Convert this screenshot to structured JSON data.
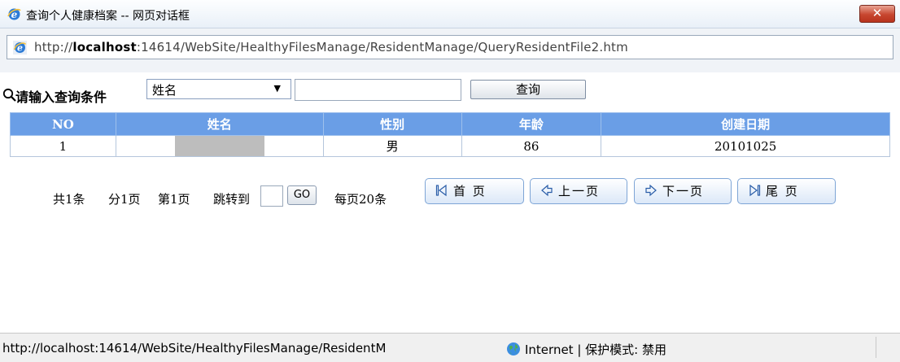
{
  "window": {
    "title": "查询个人健康档案 -- 网页对话框",
    "close_label": "✕"
  },
  "address": {
    "url_prefix": "http://",
    "url_host": "localhost",
    "url_rest": ":14614/WebSite/HealthyFilesManage/ResidentManage/QueryResidentFile2.htm"
  },
  "query": {
    "label": "请输入查询条件",
    "select_value": "姓名",
    "input_value": "",
    "button_label": "查询"
  },
  "table": {
    "headers": [
      "NO",
      "姓名",
      "性别",
      "年龄",
      "创建日期"
    ],
    "rows": [
      {
        "no": "1",
        "name": "",
        "gender": "男",
        "age": "86",
        "date": "20101025"
      }
    ]
  },
  "pager": {
    "total": "共1条",
    "pages": "分1页",
    "current": "第1页",
    "jump_label": "跳转到",
    "jump_value": "",
    "go_label": "GO",
    "per_page": "每页20条",
    "first": "首 页",
    "prev": "上一页",
    "next": "下一页",
    "last": "尾 页"
  },
  "status": {
    "url": "http://localhost:14614/WebSite/HealthyFilesManage/ResidentM",
    "zone": "Internet | 保护模式: 禁用"
  },
  "colors": {
    "header_blue": "#6a9ee6",
    "close_red": "#c7462f"
  }
}
